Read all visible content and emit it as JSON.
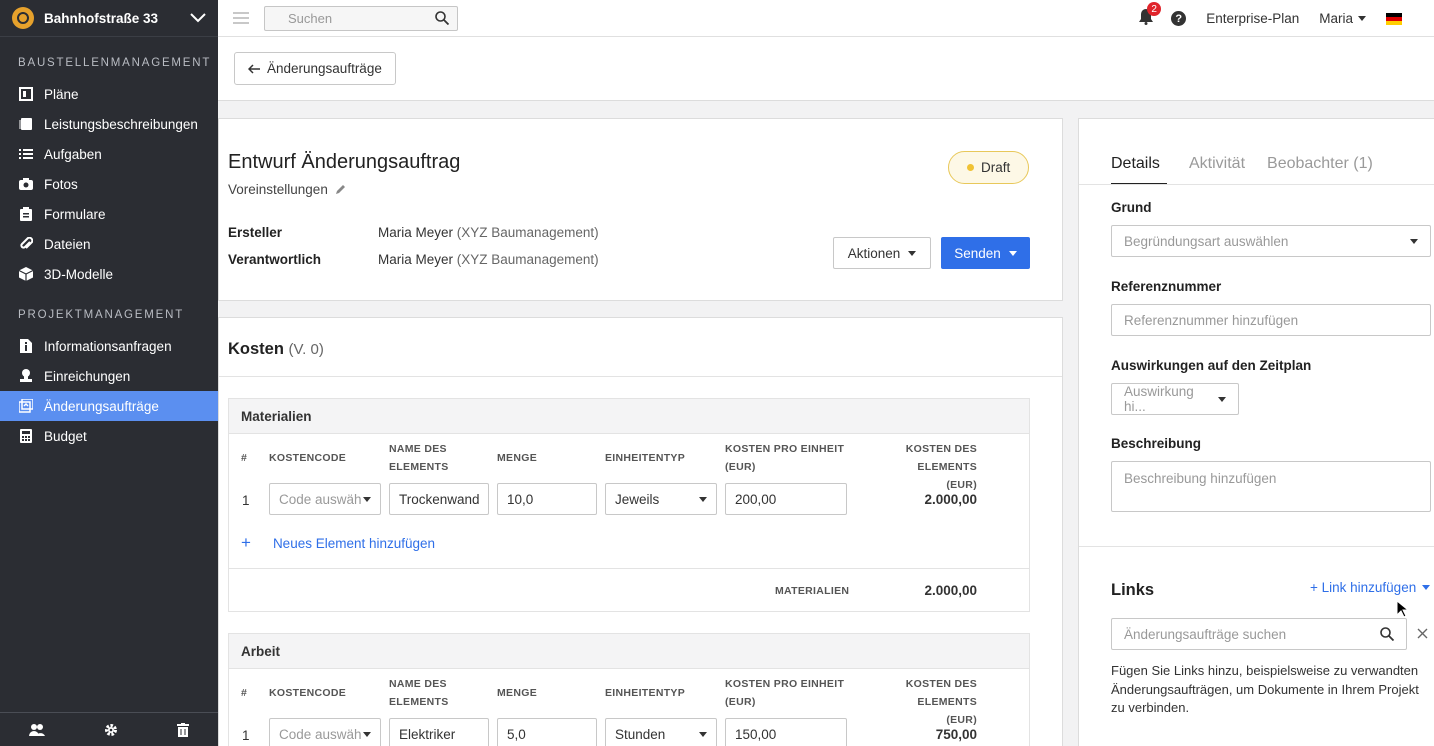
{
  "sidebar": {
    "project": "Bahnhofstraße 33",
    "section1": "BAUSTELLENMANAGEMENT",
    "section2": "PROJEKTMANAGEMENT",
    "items1": [
      "Pläne",
      "Leistungsbeschreibungen",
      "Aufgaben",
      "Fotos",
      "Formulare",
      "Dateien",
      "3D-Modelle"
    ],
    "items2": [
      "Informationsanfragen",
      "Einreichungen",
      "Änderungsaufträge",
      "Budget"
    ]
  },
  "topbar": {
    "search_placeholder": "Suchen",
    "notif_count": "2",
    "help": "?",
    "plan": "Enterprise-Plan",
    "user": "Maria"
  },
  "subhead": {
    "back": "Änderungsaufträge"
  },
  "header": {
    "title": "Entwurf Änderungsauftrag",
    "preset": "Voreinstellungen",
    "status": "Draft",
    "creator_label": "Ersteller",
    "creator_name": "Maria Meyer",
    "creator_org": "(XYZ Baumanagement)",
    "resp_label": "Verantwortlich",
    "resp_name": "Maria Meyer",
    "resp_org": "(XYZ Baumanagement)",
    "actions": "Aktionen",
    "send": "Senden"
  },
  "costs": {
    "title": "Kosten",
    "version": "(V. 0)",
    "columns": {
      "num": "#",
      "code": "KOSTENCODE",
      "name1": "NAME DES",
      "name2": "ELEMENTS",
      "qty": "MENGE",
      "unit": "EINHEITENTYP",
      "cpu1": "KOSTEN PRO EINHEIT",
      "cpu2": "(EUR)",
      "total1": "KOSTEN DES ELEMENTS",
      "total2": "(EUR)"
    },
    "materials": {
      "title": "Materialien",
      "row": {
        "num": "1",
        "code": "Code auswäh",
        "name": "Trockenwand",
        "qty": "10,0",
        "unit": "Jeweils",
        "cpu": "200,00",
        "total": "2.000,00"
      },
      "add": "Neues Element hinzufügen",
      "sum_label": "MATERIALIEN",
      "sum": "2.000,00"
    },
    "labor": {
      "title": "Arbeit",
      "row": {
        "num": "1",
        "code": "Code auswäh",
        "name": "Elektriker",
        "qty": "5,0",
        "unit": "Stunden",
        "cpu": "150,00",
        "total": "750,00"
      }
    }
  },
  "details": {
    "tabs": [
      "Details",
      "Aktivität",
      "Beobachter (1)"
    ],
    "reason_label": "Grund",
    "reason_placeholder": "Begründungsart auswählen",
    "ref_label": "Referenznummer",
    "ref_placeholder": "Referenznummer hinzufügen",
    "impact_label": "Auswirkungen auf den Zeitplan",
    "impact_placeholder": "Auswirkung hi...",
    "desc_label": "Beschreibung",
    "desc_placeholder": "Beschreibung hinzufügen",
    "links_title": "Links",
    "add_link": "+ Link hinzufügen",
    "links_search": "Änderungsaufträge suchen",
    "links_help": "Fügen Sie Links hinzu, beispielsweise zu verwandten Änderungsaufträgen, um Dokumente in Ihrem Projekt zu verbinden."
  },
  "colors": {
    "accent": "#2f6fe8",
    "active_nav": "#5b8ff0",
    "sidebar_bg": "#2b2d33"
  }
}
